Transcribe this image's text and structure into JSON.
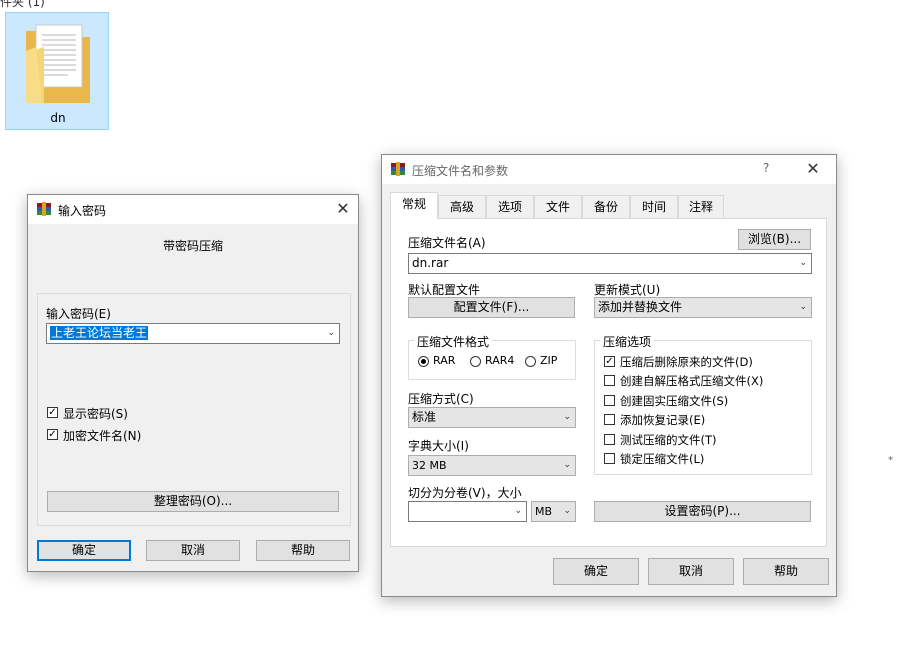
{
  "desktop": {
    "top_label_partial": "件夹 (1)",
    "folder_name": "dn"
  },
  "password_dialog": {
    "title": "输入密码",
    "subtitle": "带密码压缩",
    "password_label": "输入密码(E)",
    "password_value": "上老王论坛当老王",
    "show_password": {
      "label": "显示密码(S)",
      "checked": true
    },
    "encrypt_names": {
      "label": "加密文件名(N)",
      "checked": true
    },
    "organize_button": "整理密码(O)...",
    "ok": "确定",
    "cancel": "取消",
    "help": "帮助"
  },
  "archive_dialog": {
    "title": "压缩文件名和参数",
    "help_glyph": "?",
    "tabs": [
      "常规",
      "高级",
      "选项",
      "文件",
      "备份",
      "时间",
      "注释"
    ],
    "archive_name_label": "压缩文件名(A)",
    "browse_button": "浏览(B)...",
    "archive_name_value": "dn.rar",
    "profile_label": "默认配置文件",
    "profile_button": "配置文件(F)...",
    "update_mode_label": "更新模式(U)",
    "update_mode_value": "添加并替换文件",
    "format_group": "压缩文件格式",
    "formats": [
      "RAR",
      "RAR4",
      "ZIP"
    ],
    "format_selected": "RAR",
    "method_label": "压缩方式(C)",
    "method_value": "标准",
    "dict_label": "字典大小(I)",
    "dict_value": "32 MB",
    "split_label": "切分为分卷(V)，大小",
    "split_value": "",
    "split_unit": "MB",
    "options_group": "压缩选项",
    "options": [
      {
        "label": "压缩后删除原来的文件(D)",
        "checked": true
      },
      {
        "label": "创建自解压格式压缩文件(X)",
        "checked": false
      },
      {
        "label": "创建固实压缩文件(S)",
        "checked": false
      },
      {
        "label": "添加恢复记录(E)",
        "checked": false
      },
      {
        "label": "测试压缩的文件(T)",
        "checked": false
      },
      {
        "label": "锁定压缩文件(L)",
        "checked": false
      }
    ],
    "set_password_button": "设置密码(P)...",
    "ok": "确定",
    "cancel": "取消",
    "help": "帮助"
  },
  "colors": {
    "accent": "#0078d7",
    "selection": "#0078d7",
    "folder_tile": "#cce8ff"
  }
}
